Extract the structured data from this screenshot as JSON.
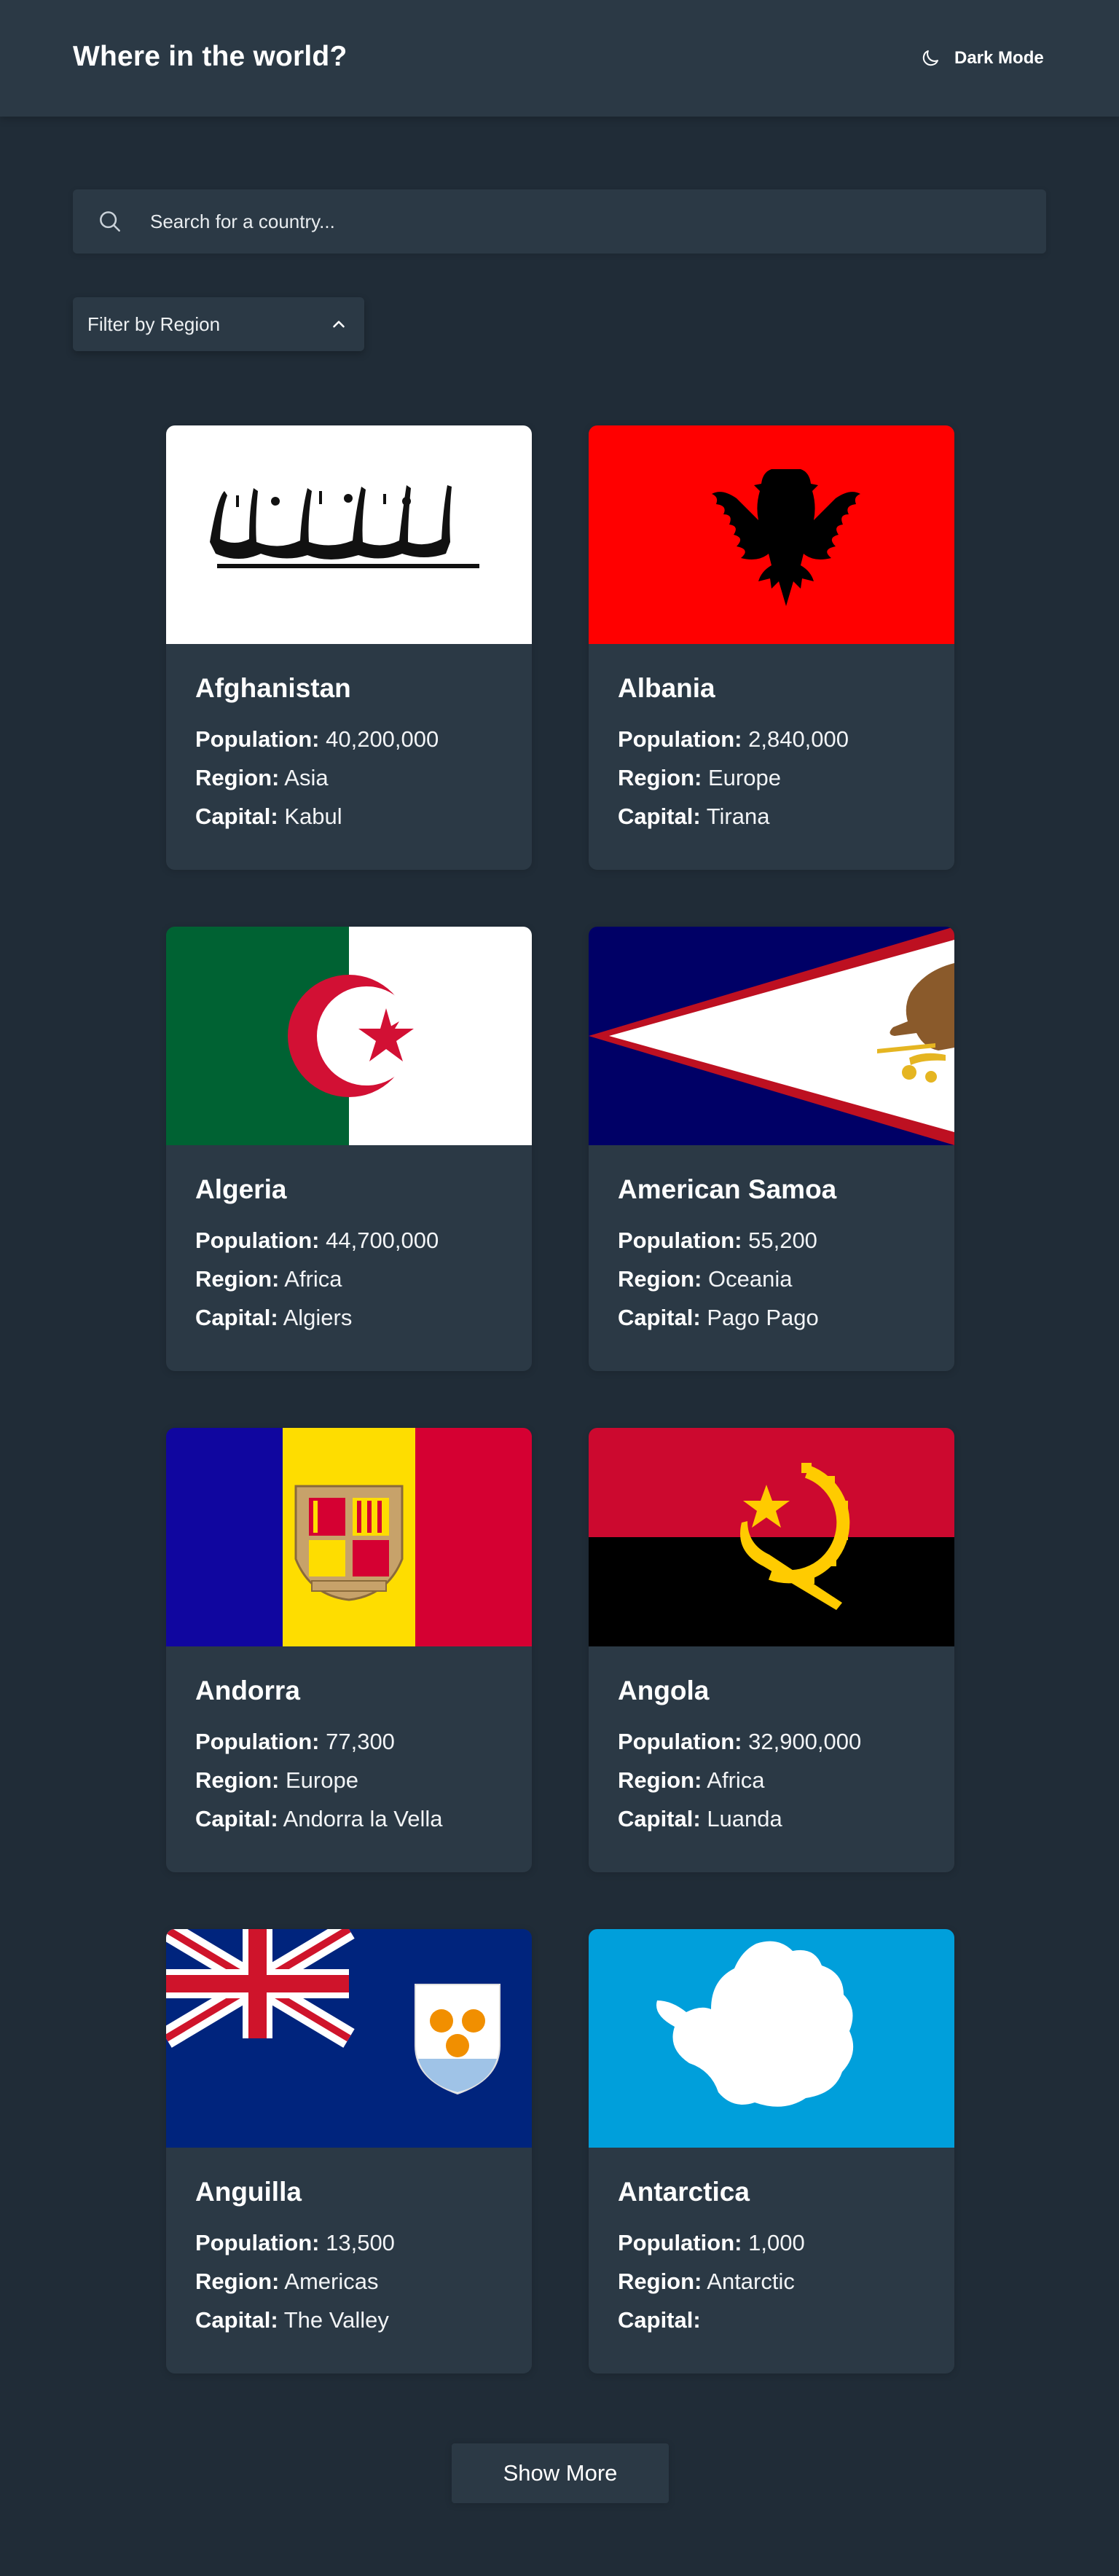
{
  "header": {
    "title": "Where in the world?",
    "theme_toggle_label": "Dark Mode",
    "theme_icon": "moon-icon"
  },
  "search": {
    "placeholder": "Search for a country...",
    "value": "",
    "icon": "search-icon"
  },
  "filter": {
    "label": "Filter by Region",
    "icon": "chevron-up-icon"
  },
  "field_labels": {
    "population": "Population:",
    "region": "Region:",
    "capital": "Capital:"
  },
  "countries": [
    {
      "name": "Afghanistan",
      "population": "40,200,000",
      "region": "Asia",
      "capital": "Kabul",
      "flag": "afghanistan-flag"
    },
    {
      "name": "Albania",
      "population": "2,840,000",
      "region": "Europe",
      "capital": "Tirana",
      "flag": "albania-flag"
    },
    {
      "name": "Algeria",
      "population": "44,700,000",
      "region": "Africa",
      "capital": "Algiers",
      "flag": "algeria-flag"
    },
    {
      "name": "American Samoa",
      "population": "55,200",
      "region": "Oceania",
      "capital": "Pago Pago",
      "flag": "american-samoa-flag"
    },
    {
      "name": "Andorra",
      "population": "77,300",
      "region": "Europe",
      "capital": "Andorra la Vella",
      "flag": "andorra-flag"
    },
    {
      "name": "Angola",
      "population": "32,900,000",
      "region": "Africa",
      "capital": "Luanda",
      "flag": "angola-flag"
    },
    {
      "name": "Anguilla",
      "population": "13,500",
      "region": "Americas",
      "capital": "The Valley",
      "flag": "anguilla-flag"
    },
    {
      "name": "Antarctica",
      "population": "1,000",
      "region": "Antarctic",
      "capital": "",
      "flag": "antarctica-flag"
    }
  ],
  "show_more_label": "Show More",
  "colors": {
    "background": "#202c37",
    "elements": "#2b3945",
    "text": "#ffffff"
  }
}
